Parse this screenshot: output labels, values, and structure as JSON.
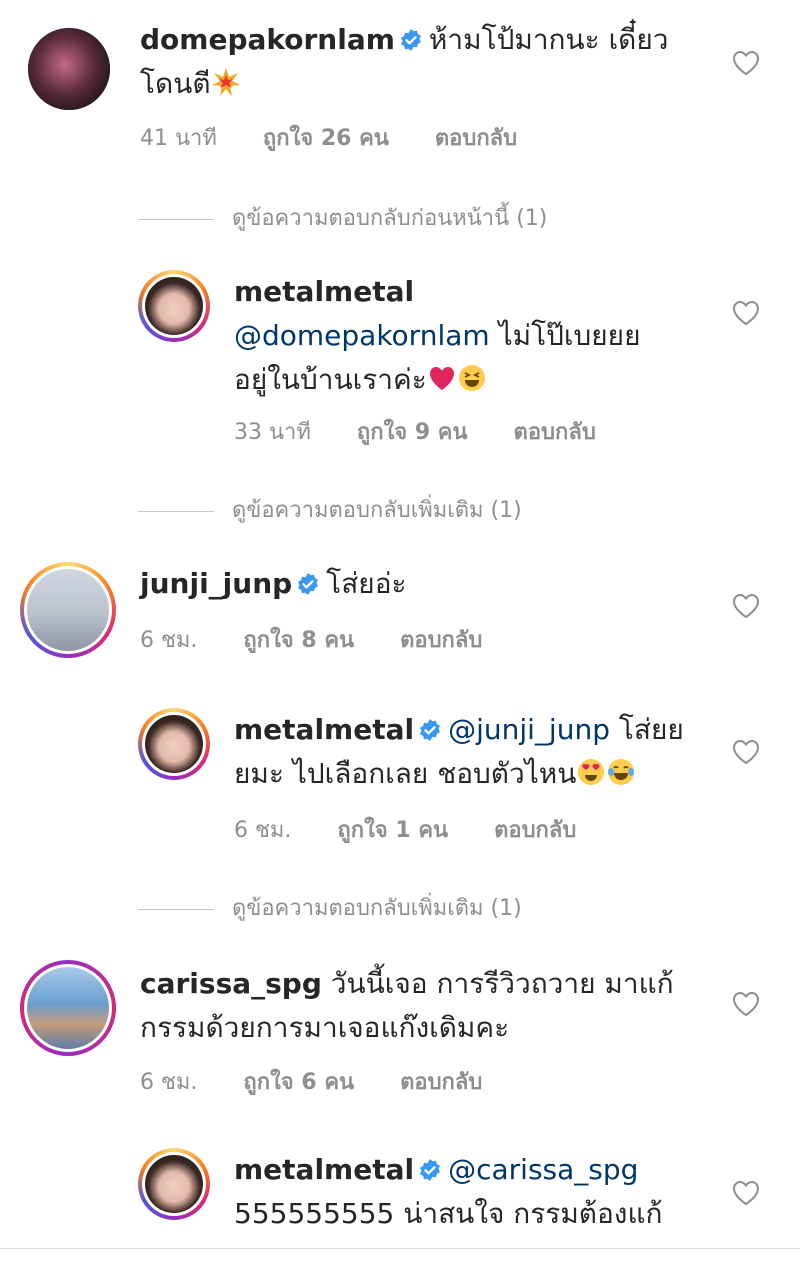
{
  "icons": {
    "verified": "verified-badge-icon",
    "heart": "heart-outline-icon"
  },
  "colors": {
    "meta_text": "#8e8e8e",
    "mention": "#00376b",
    "verified": "#3897f0",
    "heart_red": "#e0245e"
  },
  "comments": [
    {
      "username": "domepakornlam",
      "verified": true,
      "line1": "ห้ามโป้มากนะ เดี๋ยว",
      "line2": "โดนตี",
      "time": "41 นาที",
      "likes": "ถูกใจ 26 คน",
      "reply": "ตอบกลับ"
    },
    {
      "see_more": "ดูข้อความตอบกลับก่อนหน้านี้ (1)"
    },
    {
      "username": "metalmetal",
      "verified": false,
      "mention": "@domepakornlam",
      "line1_rest": " ไม่โป๊เบยยย",
      "line2": "อยู่ในบ้านเราค่ะ",
      "time": "33 นาที",
      "likes": "ถูกใจ 9 คน",
      "reply": "ตอบกลับ"
    },
    {
      "see_more": "ดูข้อความตอบกลับเพิ่มเติม (1)"
    },
    {
      "username": "junji_junp",
      "verified": true,
      "line1": "โส่ยอ่ะ",
      "time": "6 ชม.",
      "likes": "ถูกใจ 8 คน",
      "reply": "ตอบกลับ"
    },
    {
      "username": "metalmetal",
      "verified": true,
      "mention": "@junji_junp",
      "line1_rest": " โส่ยย",
      "line2": "ยมะ ไปเลือกเลย ชอบตัวไหน",
      "time": "6 ชม.",
      "likes": "ถูกใจ 1 คน",
      "reply": "ตอบกลับ"
    },
    {
      "see_more": "ดูข้อความตอบกลับเพิ่มเติม (1)"
    },
    {
      "username": "carissa_spg",
      "verified": false,
      "line1": " วันนี้เจอ การรีวิวถวาย มาแก้",
      "line2": "กรรมด้วยการมาเจอแก๊งเดิมคะ",
      "time": "6 ชม.",
      "likes": "ถูกใจ 6 คน",
      "reply": "ตอบกลับ"
    },
    {
      "username": "metalmetal",
      "verified": true,
      "mention": "@carissa_spg",
      "line2": "555555555 น่าสนใจ กรรมต้องแก้"
    }
  ]
}
